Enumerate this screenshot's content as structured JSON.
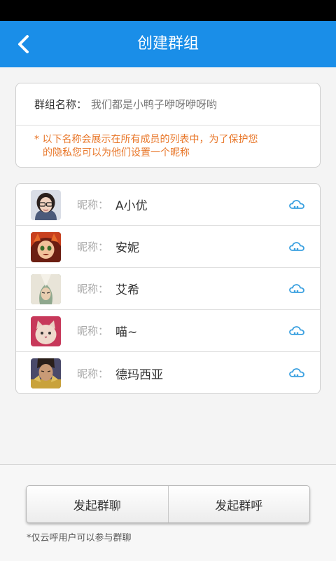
{
  "header": {
    "title": "创建群组",
    "bg_color": "#1a8ee8"
  },
  "group_info": {
    "name_label": "群组名称：",
    "name_value": "我们都是小鸭子咿呀咿呀哟",
    "notice_line1": "* 以下名称会展示在所有成员的列表中，为了保护您",
    "notice_line2": "的隐私您可以为他们设置一个昵称",
    "notice_color": "#e8772a"
  },
  "members": [
    {
      "nick_label": "昵称：",
      "nickname": "A小优",
      "avatar": "avatar-woman-glasses"
    },
    {
      "nick_label": "昵称：",
      "nickname": "安妮",
      "avatar": "avatar-annie"
    },
    {
      "nick_label": "昵称：",
      "nickname": "艾希",
      "avatar": "avatar-ashe"
    },
    {
      "nick_label": "昵称：",
      "nickname": "喵~",
      "avatar": "avatar-cat"
    },
    {
      "nick_label": "昵称：",
      "nickname": "德玛西亚",
      "avatar": "avatar-warrior"
    }
  ],
  "actions": {
    "group_chat_label": "发起群聊",
    "group_call_label": "发起群呼",
    "footnote": "*仅云呼用户可以参与群聊"
  },
  "icons": {
    "back": "chevron-left-icon",
    "cloud": "cloud-icon",
    "cloud_color": "#3aa0e0"
  }
}
